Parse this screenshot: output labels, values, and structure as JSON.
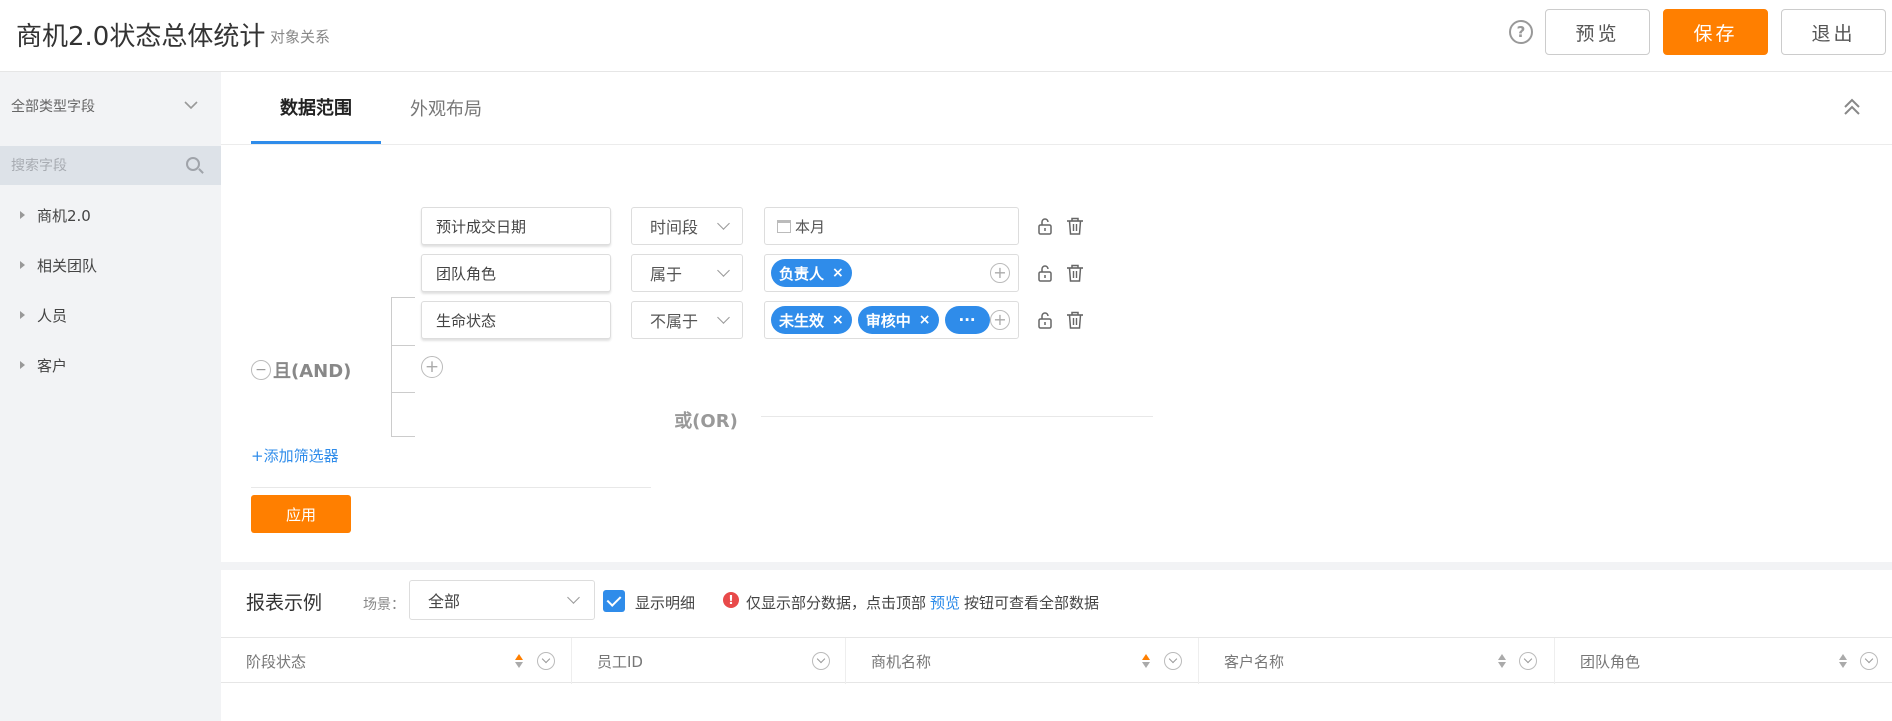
{
  "header": {
    "title": "商机2.0状态总体统计",
    "subtitle": "对象关系",
    "help": "?",
    "preview_label": "预览",
    "save_label": "保存",
    "exit_label": "退出"
  },
  "sidebar": {
    "field_type": "全部类型字段",
    "search_placeholder": "搜索字段",
    "items": [
      {
        "label": "商机2.0"
      },
      {
        "label": "相关团队"
      },
      {
        "label": "人员"
      },
      {
        "label": "客户"
      }
    ]
  },
  "tabs": [
    {
      "label": "数据范围",
      "active": true
    },
    {
      "label": "外观布局",
      "active": false
    }
  ],
  "filter": {
    "and_label": "且(AND)",
    "minus": "−",
    "conditions": [
      {
        "field": "预计成交日期",
        "operator": "时间段",
        "value": "本月"
      },
      {
        "field": "团队角色",
        "operator": "属于",
        "tags": [
          "负责人"
        ]
      },
      {
        "field": "生命状态",
        "operator": "不属于",
        "tags": [
          "未生效",
          "审核中",
          "···"
        ]
      }
    ],
    "tag_close": "×",
    "plus": "+",
    "or_label": "或(OR)",
    "add_filter": "+添加筛选器",
    "apply": "应用"
  },
  "report": {
    "title": "报表示例",
    "scene_label": "场景：",
    "scene_value": "全部",
    "show_detail": "显示明细",
    "show_detail_checked": true,
    "notice_before": "仅显示部分数据，点击顶部",
    "notice_link": "预览",
    "notice_after": "按钮可查看全部数据",
    "warn": "!",
    "columns": [
      "阶段状态",
      "员工ID",
      "商机名称",
      "客户名称",
      "团队角色"
    ]
  },
  "colors": {
    "accent": "#2f8cea",
    "primary": "#ff7f00",
    "warn": "#e84a4a"
  }
}
